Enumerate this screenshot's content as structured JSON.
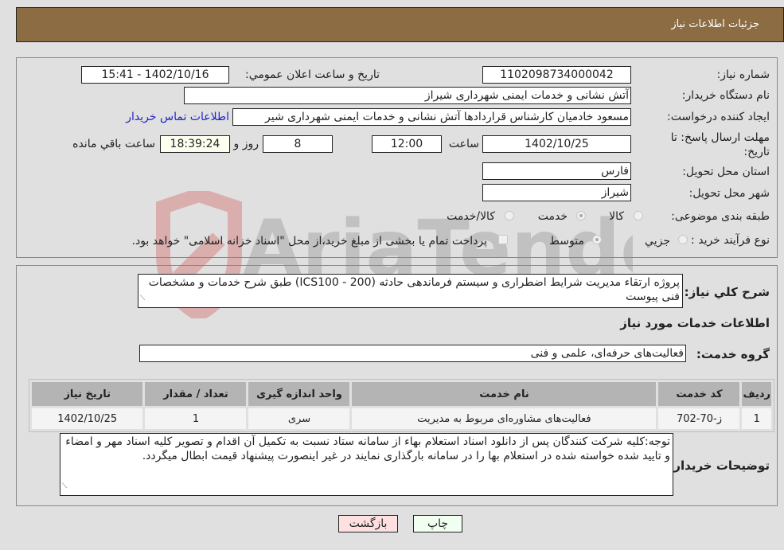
{
  "header": {
    "title": "جزئیات اطلاعات نیاز"
  },
  "form": {
    "need_number": {
      "label": "شماره نیاز:",
      "value": "1102098734000042"
    },
    "announce_datetime": {
      "label": "تاریخ و ساعت اعلان عمومي:",
      "value": "1402/10/16 - 15:41"
    },
    "buyer_org": {
      "label": "نام دستگاه خریدار:",
      "value": "آتش نشانی و خدمات ایمنی شهرداری شیراز"
    },
    "requester": {
      "label": "ایجاد کننده درخواست:",
      "value": "مسعود خادمیان کارشناس قراردادها آتش نشانی و خدمات ایمنی شهرداری شیر",
      "contact_link": "اطلاعات تماس خریدار"
    },
    "deadline": {
      "label": "مهلت ارسال پاسخ: تا تاریخ:",
      "date": "1402/10/25",
      "time_label": "ساعت",
      "time": "12:00",
      "days": "8",
      "days_label": "روز و",
      "remaining": "18:39:24",
      "remaining_label": "ساعت باقي مانده"
    },
    "province": {
      "label": "استان محل تحویل:",
      "value": "فارس"
    },
    "city": {
      "label": "شهر محل تحویل:",
      "value": "شیراز"
    },
    "category": {
      "label": "طبقه بندی موضوعی:",
      "options": [
        "کالا",
        "خدمت",
        "کالا/خدمت"
      ],
      "selected": "خدمت"
    },
    "purchase_type": {
      "label": "نوع فرآیند خرید :",
      "options": [
        "جزيي",
        "متوسط"
      ],
      "selected": "متوسط",
      "treasury_note": "پرداخت تمام یا بخشی از مبلغ خرید،از محل \"اسناد خزانه اسلامی\" خواهد بود.",
      "treasury_checked": false
    }
  },
  "description": {
    "label": "شرح کلي نیاز:",
    "value": "پروژه ارتقاء مدیریت شرایط اضطراری و سیستم فرماندهی حادثه (ICS100 - 200) طبق شرح خدمات و مشخصات فنی پیوست"
  },
  "services": {
    "section_title": "اطلاعات خدمات مورد نیاز",
    "group_label": "گروه خدمت:",
    "group_value": "فعالیت‌های حرفه‌ای، علمی و فنی",
    "columns": [
      "ردیف",
      "کد خدمت",
      "نام خدمت",
      "واحد اندازه گیری",
      "تعداد / مقدار",
      "تاریخ نیاز"
    ],
    "rows": [
      [
        "1",
        "ز-70-702",
        "فعالیت‌های مشاوره‌ای مربوط به مدیریت",
        "سری",
        "1",
        "1402/10/25"
      ]
    ]
  },
  "buyer_notes": {
    "label": "توضیحات خریدار:",
    "value": "توجه:کلیه شرکت کنندگان پس از دانلود اسناد استعلام بهاء  از سامانه ستاد نسبت به تکمیل آن اقدام و تصویر کلیه اسناد مهر و امضاء و تایید شده خواسته شده در استعلام بها را در سامانه بارگذاری نمایند در غیر اینصورت پیشنهاد قیمت ابطال میگردد."
  },
  "buttons": {
    "print": "چاپ",
    "back": "بازگشت"
  },
  "watermark": {
    "text": "AriaTender.neT"
  },
  "colors": {
    "header_bg": "#8c6d43",
    "link": "#2222cc",
    "print_bg": "#f0fff0",
    "back_bg": "#ffe0e0"
  }
}
